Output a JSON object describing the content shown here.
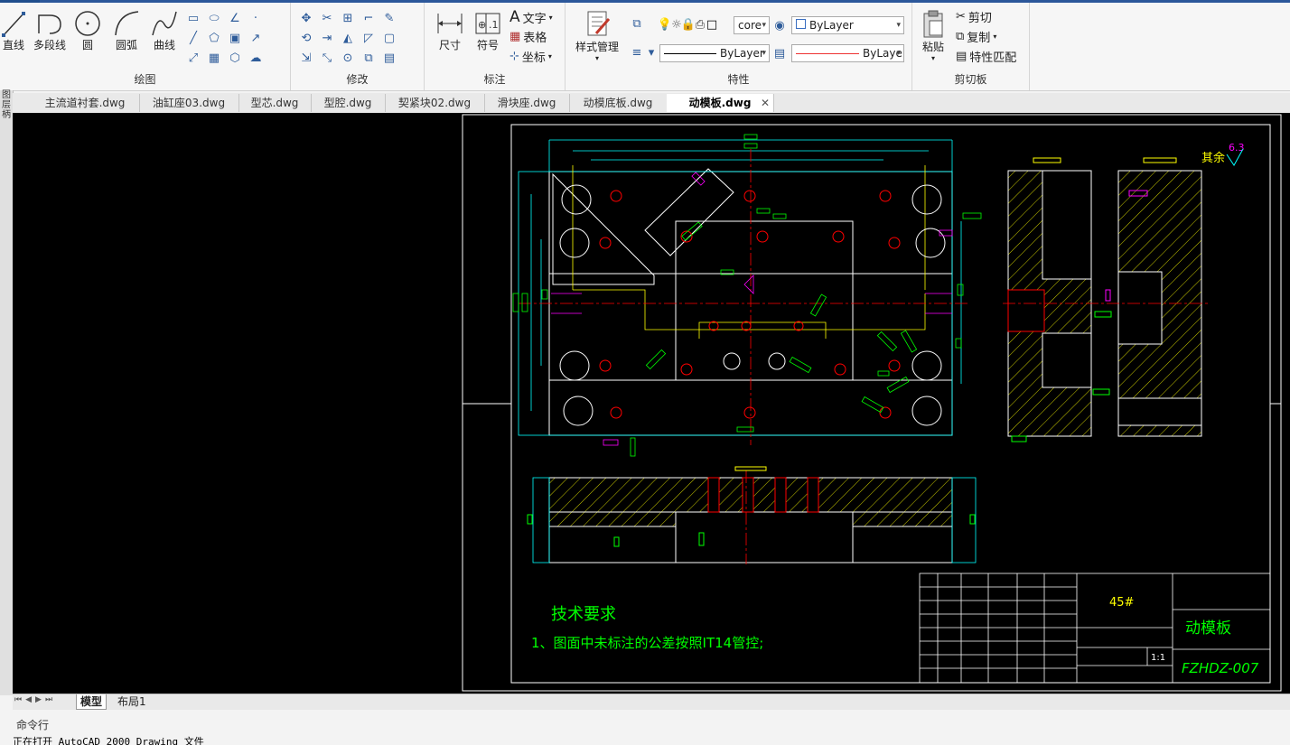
{
  "ribbon": {
    "draw": {
      "title": "绘图",
      "line": "直线",
      "polyline": "多段线",
      "circle": "圆",
      "arc": "圆弧",
      "spline": "曲线"
    },
    "modify": {
      "title": "修改"
    },
    "annotate": {
      "title": "标注",
      "dimension": "尺寸",
      "symbol": "符号",
      "text": "文字",
      "table": "表格",
      "coord": "坐标"
    },
    "properties": {
      "title": "特性",
      "style_manager": "样式管理",
      "layer_value": "core",
      "color_value": "ByLayer",
      "linetype_value": "ByLayer",
      "lineweight_value": "ByLaye"
    },
    "clipboard": {
      "title": "剪切板",
      "paste": "粘贴",
      "cut": "剪切",
      "copy": "复制",
      "match": "特性匹配"
    }
  },
  "left_strip": [
    "图",
    "层",
    "柄"
  ],
  "tabs": [
    {
      "label": "主流道衬套.dwg"
    },
    {
      "label": "油缸座03.dwg"
    },
    {
      "label": "型芯.dwg"
    },
    {
      "label": "型腔.dwg"
    },
    {
      "label": "契紧块02.dwg"
    },
    {
      "label": "滑块座.dwg"
    },
    {
      "label": "动模底板.dwg"
    },
    {
      "label": "动模板.dwg"
    }
  ],
  "drawing": {
    "roughness_label": "其余",
    "roughness_value": "6.3",
    "tech_title": "技术要求",
    "tech_note": "1、图面中未标注的公差按照IT14管控;",
    "material": "45#",
    "part_name": "动模板",
    "part_code": "FZHDZ-007",
    "scale": "1:1"
  },
  "layout_tabs": {
    "model": "模型",
    "layout1": "布局1"
  },
  "command": {
    "label": "命令行",
    "line": "正在打开 AutoCAD 2000 Drawing 文件"
  },
  "colors": {
    "canvas": "#000000",
    "cyan": "#00ffff",
    "white": "#ffffff",
    "yellow": "#ffff00",
    "green": "#00ff00",
    "red": "#ff0000",
    "magenta": "#ff00ff",
    "accent": "#2b579a"
  }
}
